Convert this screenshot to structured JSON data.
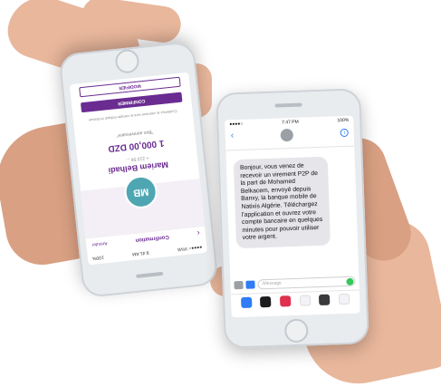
{
  "left_phone": {
    "status_carrier": "●●●●○ VIVA",
    "status_time": "9:41 AM",
    "status_battery": "100%",
    "nav_back": "‹",
    "nav_title": "Confirmation",
    "nav_cancel": "Annuler",
    "avatar_initials": "MB",
    "recipient_name": "Mariem Belhadi",
    "recipient_sub": "+ 213 56 ...",
    "amount": "1 000,00 DZD",
    "memo": "\"Bon anniversaire\"",
    "note": "Confirmez le virement vers le compte indiqué ci-dessus",
    "primary_button": "CONFIRMER",
    "secondary_button": "MODIFIER",
    "accent_color": "#6a2c91",
    "avatar_color": "#4fa6b3"
  },
  "right_phone": {
    "status_carrier": "●●●●○",
    "status_time": "7:47 PM",
    "status_battery": "100%",
    "back_icon": "chevron-left-icon",
    "info_glyph": "i",
    "message": "Bonjour, vous venez de recevoir un virement P2P de la part de Mohamed Belkacem, envoyé depuis Banxy, la banque mobile de Natixis Algérie. Téléchargez l'application et ouvrez votre compte bancaire en quelques minutes pour pouvoir utiliser votre argent.",
    "input_placeholder": "iMessage",
    "link_color": "#2f7cf6"
  }
}
